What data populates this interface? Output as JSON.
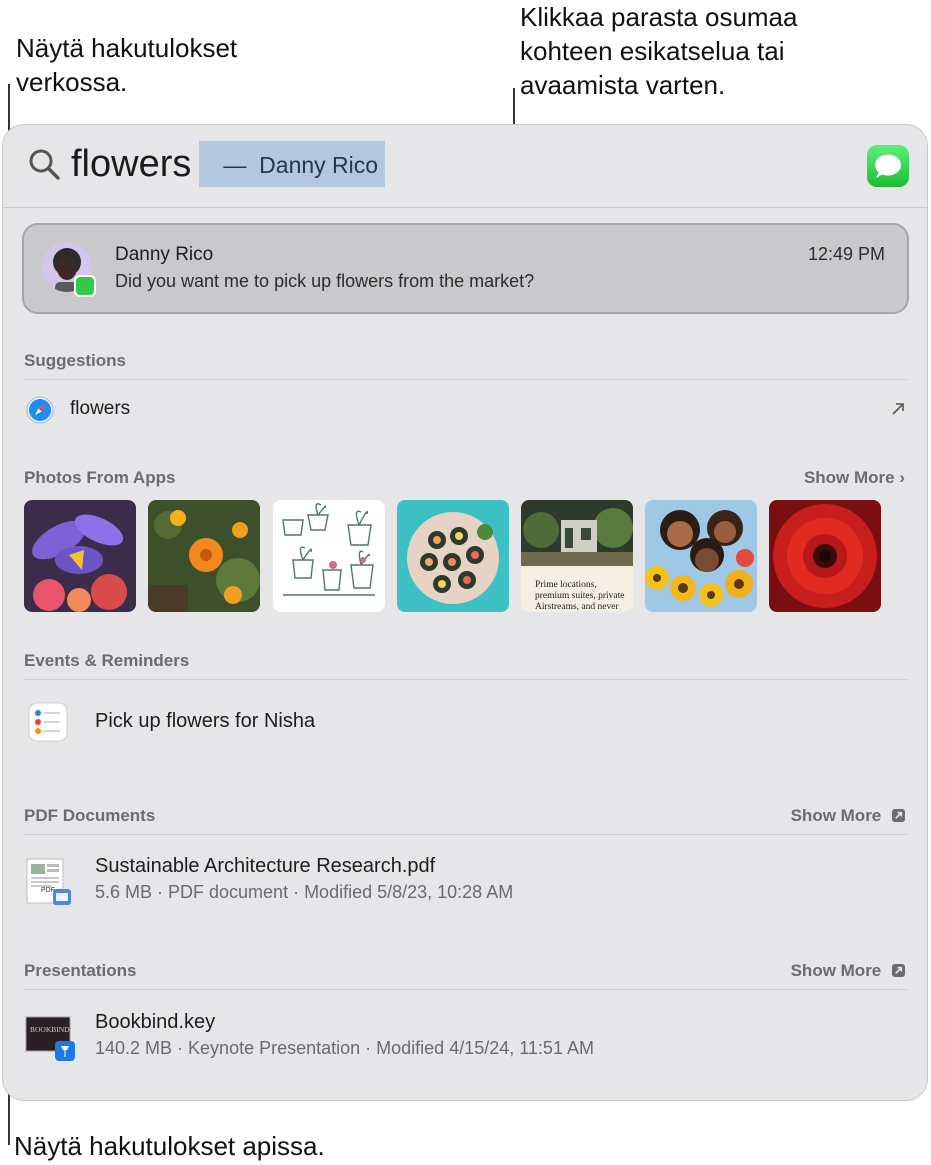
{
  "callouts": {
    "web": "Näytä hakutulokset\nverkossa.",
    "top_hit": "Klikkaa parasta osumaa\nkohteen esikatselua tai\navaamista varten.",
    "in_app": "Näytä hakutulokset apissa."
  },
  "search": {
    "query": "flowers",
    "completion": " —  Danny Rico"
  },
  "top_hit": {
    "name": "Danny Rico",
    "time": "12:49 PM",
    "text": "Did you want me to pick up flowers from the market?"
  },
  "suggestions": {
    "title": "Suggestions",
    "item": "flowers"
  },
  "photos": {
    "title": "Photos From Apps",
    "show_more": "Show More ›",
    "items": [
      {
        "name": "iris-flowers-photo"
      },
      {
        "name": "calendula-photo"
      },
      {
        "name": "plant-sketch-photo"
      },
      {
        "name": "sushi-plate-photo"
      },
      {
        "name": "magazine-article-photo",
        "caption": "Prime locations, premium suites, private Airstreams, and never"
      },
      {
        "name": "friends-sunflowers-photo"
      },
      {
        "name": "red-gerbera-photo"
      }
    ]
  },
  "events": {
    "title": "Events & Reminders",
    "item": "Pick up flowers for Nisha"
  },
  "pdf": {
    "title": "PDF Documents",
    "show_more": "Show More",
    "item_title": "Sustainable Architecture Research.pdf",
    "item_sub": "5.6 MB · PDF document · Modified 5/8/23, 10:28 AM",
    "icon_label": "PDF"
  },
  "presentations": {
    "title": "Presentations",
    "show_more": "Show More",
    "item_title": "Bookbind.key",
    "item_sub": "140.2 MB · Keynote Presentation · Modified 4/15/24, 11:51 AM",
    "icon_label": "BOOKBIND"
  },
  "colors": {
    "accent_completion": "#b3c7df",
    "messages_green": "#2ecc47"
  }
}
